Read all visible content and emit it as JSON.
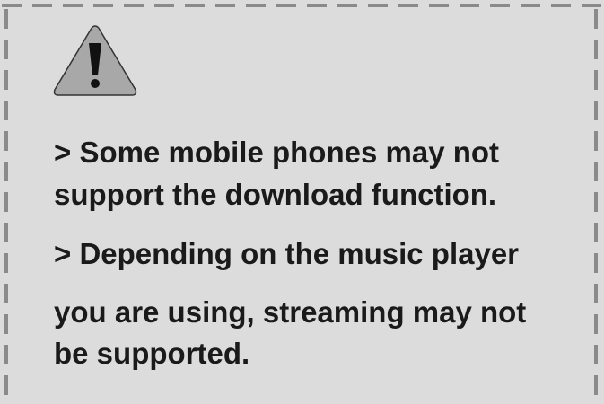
{
  "notice": {
    "icon": "warning-triangle-exclamation-icon",
    "lines": [
      "> Some mobile phones may not",
      "support the download function.",
      "> Depending on the music player",
      "you are using, streaming may not",
      "be supported."
    ]
  },
  "colors": {
    "panel_background": "#dcdcdc",
    "dashed_border": "#8a8a8a",
    "icon_fill": "#a8a8a8",
    "text": "#1a1a1a"
  }
}
